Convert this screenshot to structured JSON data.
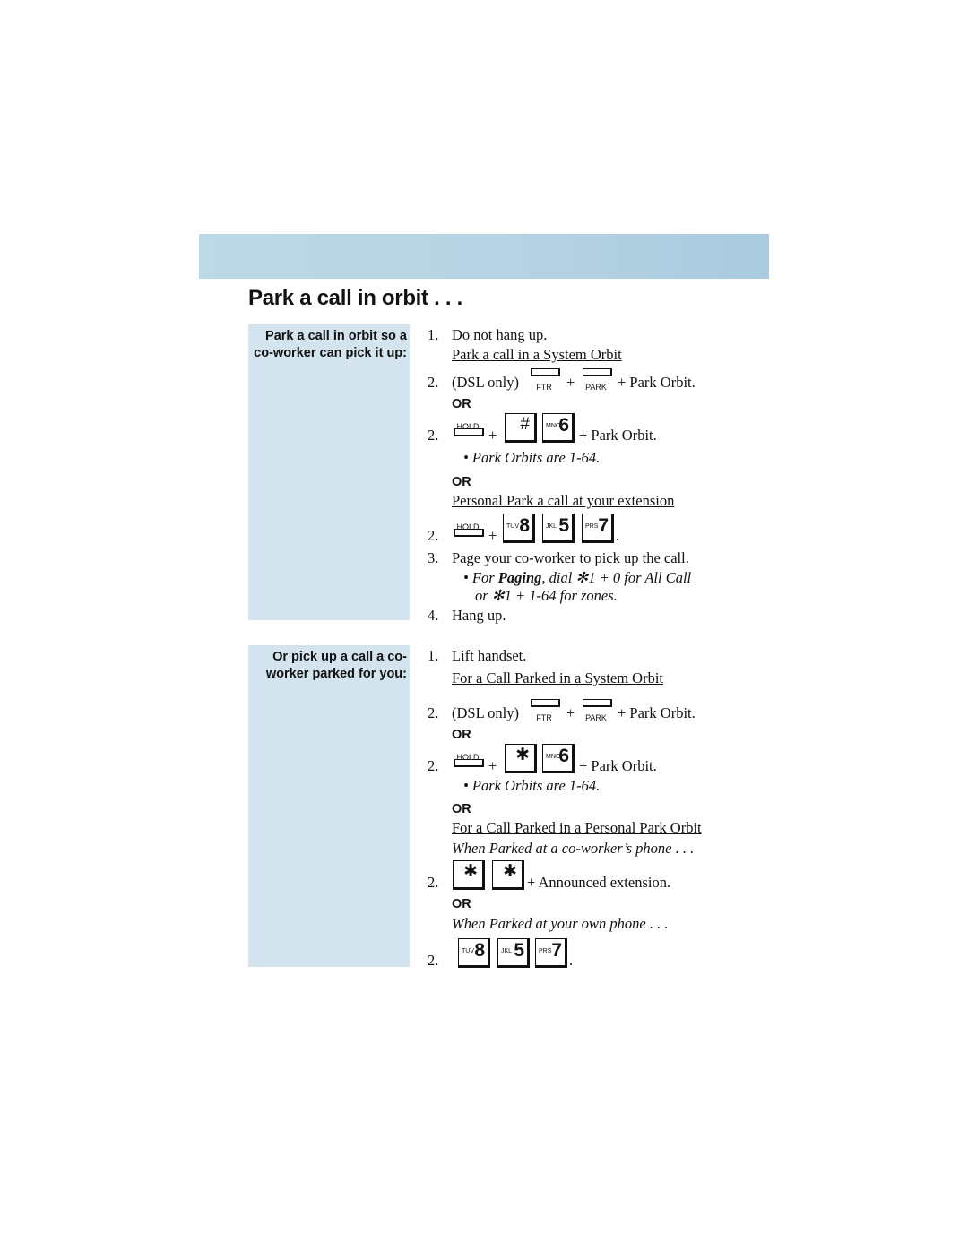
{
  "page": {
    "title": "Park a call in orbit . . .",
    "colors": {
      "banner": "#b7d4e4",
      "sidebar": "#d3e4ef"
    }
  },
  "section1": {
    "side_label": "Park a call in orbit so a co-worker can pick it up:",
    "step1_num": "1.",
    "step1_text": "Do not hang up.",
    "heading1": "Park a call in a System Orbit",
    "dsl_num": "2.",
    "dsl_text": "(DSL only)",
    "plus": "+",
    "ftr_key": "FTR",
    "park_key": "PARK",
    "park_orbit": "+ Park Orbit.",
    "or": "OR",
    "hold_num": "2.",
    "hold_key": "HOLD",
    "hash_key": "#",
    "mno_letters": "MNO",
    "mno_digit": "6",
    "note1": "• Park Orbits are 1-64.",
    "heading2": "Personal Park a call at your extension",
    "personal_num": "2.",
    "tuv_letters": "TUV",
    "tuv_digit": "8",
    "jkl_letters": "JKL",
    "jkl_digit": "5",
    "prs_letters": "PRS",
    "prs_digit": "7",
    "period": ".",
    "step3_num": "3.",
    "step3_text": "Page your co-worker to pick up the call.",
    "paging_note_a": "• For ",
    "paging_note_bold": "Paging",
    "paging_note_b": ", dial ✻1 + 0  for All Call",
    "paging_note_c": "or ✻1 + 1-64 for zones.",
    "step4_num": "4.",
    "step4_text": "Hang up."
  },
  "section2": {
    "side_label": "Or pick up a call a co-worker parked for you:",
    "step1_num": "1.",
    "step1_text": "Lift handset.",
    "heading1": "For a Call Parked in a System Orbit",
    "dsl_num": "2.",
    "dsl_text": "(DSL only)",
    "plus": "+",
    "ftr_key": "FTR",
    "park_key": "PARK",
    "park_orbit": "+ Park Orbit.",
    "or": "OR",
    "hold_num": "2.",
    "hold_key": "HOLD",
    "star_key": "✱",
    "mno_letters": "MNO",
    "mno_digit": "6",
    "note1": "• Park Orbits are 1-64.",
    "heading2": "For a Call Parked in a Personal Park Orbit",
    "sub1": "When Parked at a co-worker’s phone . . .",
    "cow_num": "2.",
    "announced": "+ Announced extension.",
    "sub2": "When Parked at your own phone . . .",
    "own_num": "2.",
    "tuv_letters": "TUV",
    "tuv_digit": "8",
    "jkl_letters": "JKL",
    "jkl_digit": "5",
    "prs_letters": "PRS",
    "prs_digit": "7",
    "period": "."
  }
}
